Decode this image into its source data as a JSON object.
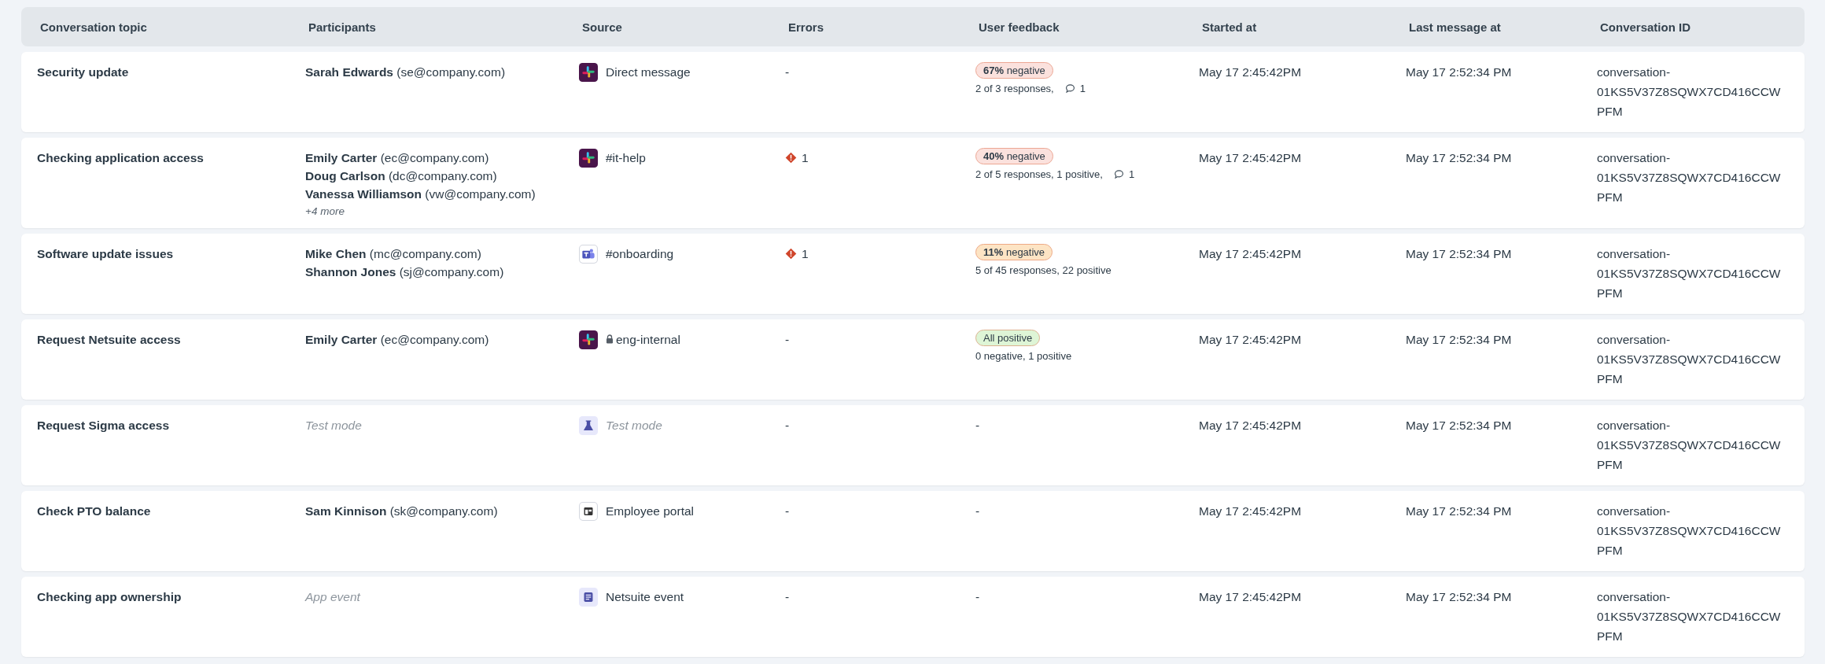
{
  "columns": [
    "Conversation topic",
    "Participants",
    "Source",
    "Errors",
    "User feedback",
    "Started at",
    "Last message at",
    "Conversation ID"
  ],
  "rows": [
    {
      "topic": "Security update",
      "participants": [
        {
          "name": "Sarah Edwards",
          "email": "(se@company.com)"
        }
      ],
      "source": {
        "kind": "slack",
        "locked": false,
        "label": "Direct message"
      },
      "errors": {
        "kind": "none",
        "text": "-"
      },
      "feedback": {
        "kind": "badge",
        "color": "#fbe1dd",
        "badge": "**67%** negative",
        "summary": "2 of 3 responses,",
        "comments": "1"
      },
      "started": "May 17 2:45:42PM",
      "last": "May 17 2:52:34 PM",
      "id": "conversation-01KS5V37Z8SQWX7CD416CCWPFM"
    },
    {
      "topic": "Checking application access",
      "participants": [
        {
          "name": "Emily Carter",
          "email": "(ec@company.com)"
        },
        {
          "name": "Doug Carlson",
          "email": "(dc@company.com)"
        },
        {
          "name": "Vanessa Williamson",
          "email": "(vw@company.com)"
        }
      ],
      "more": "+4 more",
      "source": {
        "kind": "slack",
        "locked": false,
        "label": "#it-help"
      },
      "errors": {
        "kind": "count",
        "text": "1"
      },
      "feedback": {
        "kind": "badge",
        "color": "#fbe1dd",
        "badge": "**40%** negative",
        "summary": "2 of 5 responses, 1 positive,",
        "comments": "1"
      },
      "started": "May 17 2:45:42PM",
      "last": "May 17 2:52:34 PM",
      "id": "conversation-01KS5V37Z8SQWX7CD416CCWPFM"
    },
    {
      "topic": "Software update issues",
      "participants": [
        {
          "name": "Mike Chen",
          "email": "(mc@company.com)"
        },
        {
          "name": "Shannon Jones",
          "email": "(sj@company.com)"
        }
      ],
      "source": {
        "kind": "teams",
        "locked": false,
        "label": "#onboarding"
      },
      "errors": {
        "kind": "count",
        "text": "1"
      },
      "feedback": {
        "kind": "badge",
        "color": "#fde4c4",
        "badge": "**11%** negative",
        "summary": "5 of 45 responses, 22 positive"
      },
      "started": "May 17 2:45:42PM",
      "last": "May 17 2:52:34 PM",
      "id": "conversation-01KS5V37Z8SQWX7CD416CCWPFM"
    },
    {
      "topic": "Request Netsuite access",
      "participants": [
        {
          "name": "Emily Carter",
          "email": "(ec@company.com)"
        }
      ],
      "source": {
        "kind": "slack",
        "locked": true,
        "label": "eng-internal"
      },
      "errors": {
        "kind": "none",
        "text": "-"
      },
      "feedback": {
        "kind": "badge",
        "color": "#def5d6",
        "badge": "All positive",
        "summary": "0 negative, 1 positive"
      },
      "started": "May 17 2:45:42PM",
      "last": "May 17 2:52:34 PM",
      "id": "conversation-01KS5V37Z8SQWX7CD416CCWPFM"
    },
    {
      "topic": "Request Sigma access",
      "participants_note": "Test mode",
      "source": {
        "kind": "test",
        "locked": false,
        "label": "Test mode"
      },
      "errors": {
        "kind": "none",
        "text": "-"
      },
      "feedback": {
        "kind": "none",
        "text": "-"
      },
      "started": "May 17 2:45:42PM",
      "last": "May 17 2:52:34 PM",
      "id": "conversation-01KS5V37Z8SQWX7CD416CCWPFM"
    },
    {
      "topic": "Check PTO balance",
      "participants": [
        {
          "name": "Sam Kinnison",
          "email": "(sk@company.com)"
        }
      ],
      "source": {
        "kind": "portal",
        "locked": false,
        "label": "Employee portal"
      },
      "errors": {
        "kind": "none",
        "text": "-"
      },
      "feedback": {
        "kind": "none",
        "text": "-"
      },
      "started": "May 17 2:45:42PM",
      "last": "May 17 2:52:34 PM",
      "id": "conversation-01KS5V37Z8SQWX7CD416CCWPFM"
    },
    {
      "topic": "Checking app ownership",
      "participants_note": "App event",
      "source": {
        "kind": "event",
        "locked": false,
        "label": "Netsuite event"
      },
      "errors": {
        "kind": "none",
        "text": "-"
      },
      "feedback": {
        "kind": "none",
        "text": "-"
      },
      "started": "May 17 2:45:42PM",
      "last": "May 17 2:52:34 PM",
      "id": "conversation-01KS5V37Z8SQWX7CD416CCWPFM"
    }
  ]
}
